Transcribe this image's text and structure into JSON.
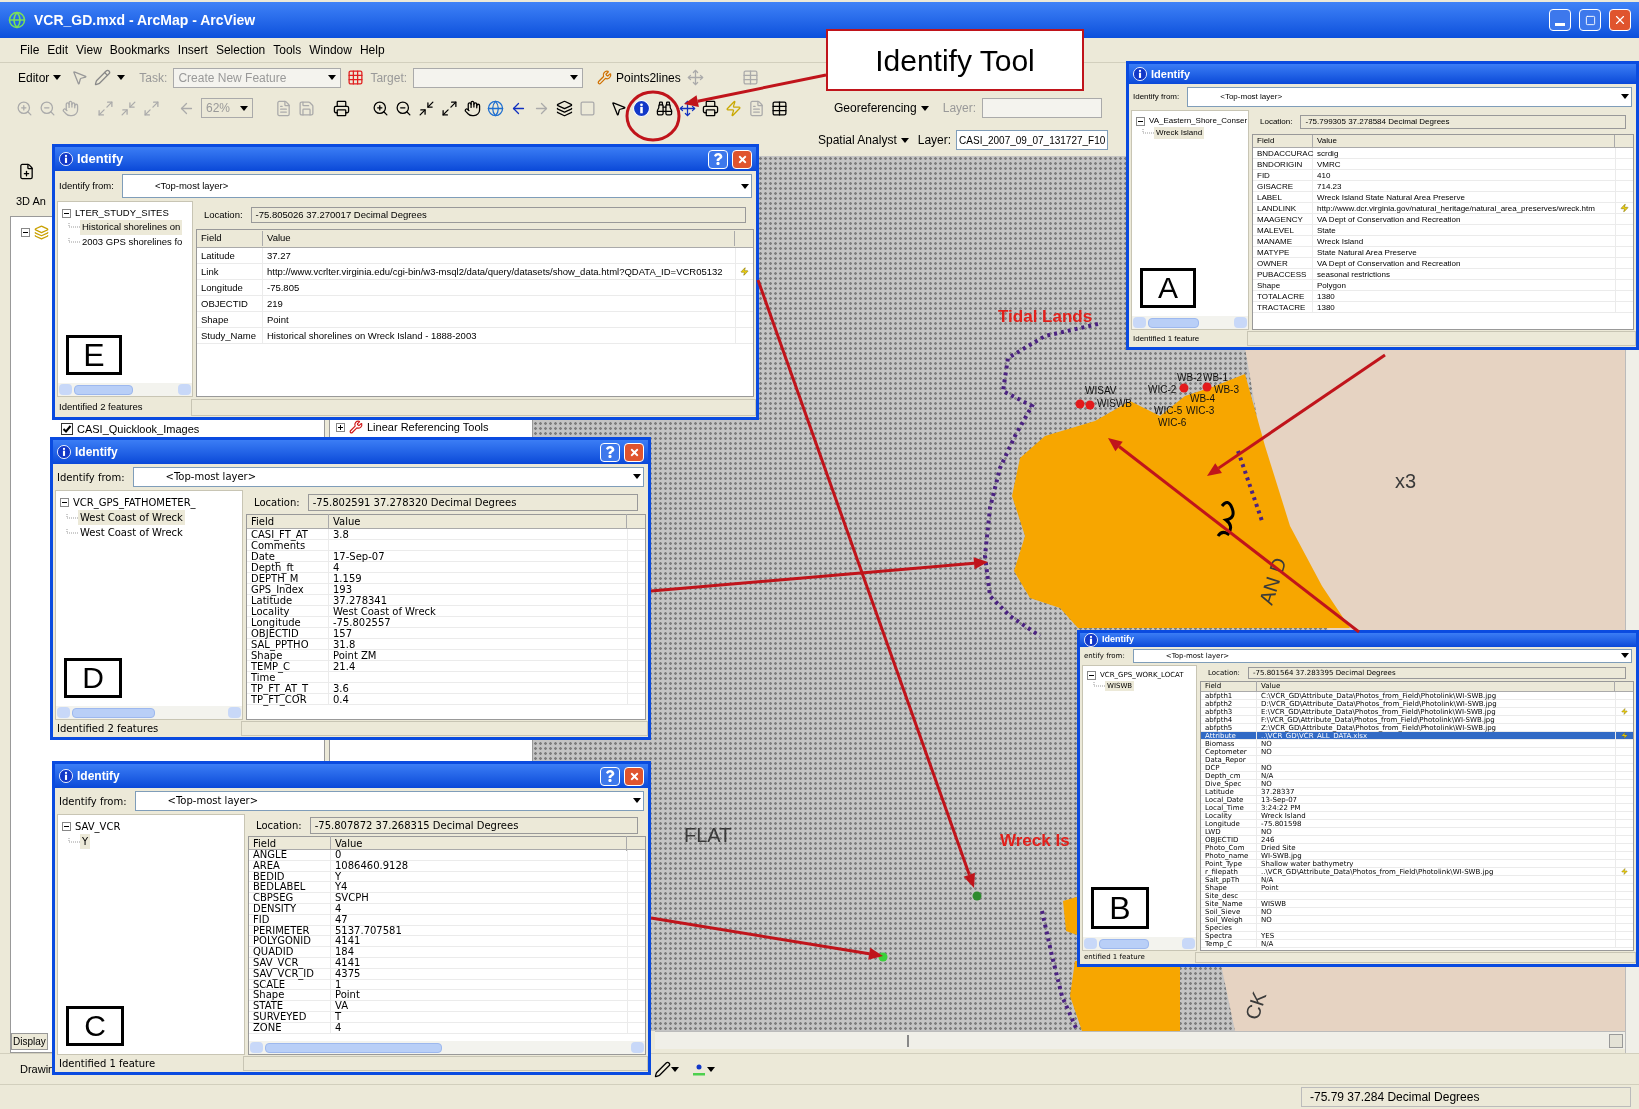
{
  "window": {
    "title": "VCR_GD.mxd - ArcMap - ArcView"
  },
  "menu": [
    "File",
    "Edit",
    "View",
    "Bookmarks",
    "Insert",
    "Selection",
    "Tools",
    "Window",
    "Help"
  ],
  "editor_toolbar": {
    "editor": "Editor",
    "task_label": "Task:",
    "task": "Create New Feature",
    "target_label": "Target:",
    "tool": "Points2lines"
  },
  "tools_toolbar": {
    "zoom": "62%"
  },
  "georef_toolbar": {
    "label": "Georeferencing",
    "layer_label": "Layer:"
  },
  "spatial_toolbar": {
    "label": "Spatial Analyst",
    "layer_label": "Layer:",
    "layer": "CASI_2007_09_07_131727_F10"
  },
  "side_toolbar": {
    "label": "3D An"
  },
  "toc": {
    "item": "CASI_Quicklook_Images",
    "checked": true,
    "tab": "Display"
  },
  "toolbox": {
    "item": "Linear Referencing Tools"
  },
  "drawing_toolbar": {
    "label": "Drawin"
  },
  "map": {
    "labels": [
      {
        "text": "Tidal Lands",
        "kind": "place"
      },
      {
        "text": "FLAT",
        "kind": "terrain"
      },
      {
        "text": "Wreck Is",
        "kind": "place"
      },
      {
        "text": "AN D",
        "kind": "terrain"
      },
      {
        "text": "x3",
        "kind": "terrain"
      },
      {
        "text": "CK",
        "kind": "terrain"
      },
      {
        "text": "WISAV",
        "kind": "site"
      },
      {
        "text": "WISWB",
        "kind": "site"
      },
      {
        "text": "WB-2",
        "kind": "site"
      },
      {
        "text": "WB-1",
        "kind": "site"
      },
      {
        "text": "WIC-2",
        "kind": "site"
      },
      {
        "text": "WB-4",
        "kind": "site"
      },
      {
        "text": "WB-3",
        "kind": "site"
      },
      {
        "text": "WIC-5",
        "kind": "site"
      },
      {
        "text": "WIC-3",
        "kind": "site"
      },
      {
        "text": "WIC-6",
        "kind": "site"
      }
    ],
    "points": [
      {
        "color": "#e31a1c"
      },
      {
        "color": "#e31a1c"
      },
      {
        "color": "#e31a1c"
      },
      {
        "color": "#e31a1c"
      },
      {
        "color": "#2e8b2e"
      },
      {
        "color": "#3ad13a"
      }
    ]
  },
  "callout": {
    "text": "Identify Tool"
  },
  "identify_windows": [
    {
      "marker": "A",
      "title": "Identify",
      "title_buttons": false,
      "from_label": "Identify from:",
      "from": "<Top-most layer>",
      "layer": "VA_Eastern_Shore_Conser",
      "features": [
        {
          "name": "Wreck Island",
          "selected": true
        }
      ],
      "location_label": "Location:",
      "location": "-75.799305  37.278584 Decimal Degrees",
      "columns": [
        "Field",
        "Value"
      ],
      "rows": [
        {
          "field": "BNDACCURAC",
          "value": "scrdig",
          "link": false,
          "selected": false
        },
        {
          "field": "BNDORIGIN",
          "value": "VMRC",
          "link": false,
          "selected": false
        },
        {
          "field": "FID",
          "value": "410",
          "link": false,
          "selected": false
        },
        {
          "field": "GISACRE",
          "value": "714.23",
          "link": false,
          "selected": false
        },
        {
          "field": "LABEL",
          "value": "Wreck Island State Natural Area Preserve",
          "link": false,
          "selected": false
        },
        {
          "field": "LANDLINK",
          "value": "http://www.dcr.virginia.gov/natural_heritage/natural_area_preserves/wreck.htm",
          "link": true,
          "selected": false
        },
        {
          "field": "MAAGENCY",
          "value": "VA Dept of Conservation and Recreation",
          "link": false,
          "selected": false
        },
        {
          "field": "MALEVEL",
          "value": "State",
          "link": false,
          "selected": false
        },
        {
          "field": "MANAME",
          "value": "Wreck Island",
          "link": false,
          "selected": false
        },
        {
          "field": "MATYPE",
          "value": "State Natural Area Preserve",
          "link": false,
          "selected": false
        },
        {
          "field": "OWNER",
          "value": "VA Dept of Conservation and Recreation",
          "link": false,
          "selected": false
        },
        {
          "field": "PUBACCESS",
          "value": "seasonal restrictions",
          "link": false,
          "selected": false
        },
        {
          "field": "Shape",
          "value": "Polygon",
          "link": false,
          "selected": false
        },
        {
          "field": "TOTALACRE",
          "value": "1380",
          "link": false,
          "selected": false
        },
        {
          "field": "TRACTACRE",
          "value": "1380",
          "link": false,
          "selected": false
        }
      ],
      "status": "Identified 1 feature"
    },
    {
      "marker": "E",
      "title": "Identify",
      "title_buttons": true,
      "from_label": "Identify from:",
      "from": "<Top-most layer>",
      "layer": "LTER_STUDY_SITES",
      "features": [
        {
          "name": "Historical shorelines on",
          "selected": true
        },
        {
          "name": "2003 GPS shorelines fo",
          "selected": false
        }
      ],
      "location_label": "Location:",
      "location": "-75.805026  37.270017 Decimal Degrees",
      "columns": [
        "Field",
        "Value"
      ],
      "rows": [
        {
          "field": "Latitude",
          "value": "37.27",
          "link": false,
          "selected": false
        },
        {
          "field": "Link",
          "value": "http://www.vcrlter.virginia.edu/cgi-bin/w3-msql2/data/query/datasets/show_data.html?QDATA_ID=VCR05132",
          "link": true,
          "selected": false
        },
        {
          "field": "Longitude",
          "value": "-75.805",
          "link": false,
          "selected": false
        },
        {
          "field": "OBJECTID",
          "value": "219",
          "link": false,
          "selected": false
        },
        {
          "field": "Shape",
          "value": "Point",
          "link": false,
          "selected": false
        },
        {
          "field": "Study_Name",
          "value": "Historical shorelines on Wreck Island - 1888-2003",
          "link": false,
          "selected": false
        }
      ],
      "status": "Identified 2 features"
    },
    {
      "marker": "D",
      "title": "Identify",
      "title_buttons": true,
      "from_label": "Identify from:",
      "from": "<Top-most layer>",
      "layer": "VCR_GPS_FATHOMETER_",
      "features": [
        {
          "name": "West Coast of Wreck",
          "selected": true
        },
        {
          "name": "West Coast of Wreck",
          "selected": false
        }
      ],
      "location_label": "Location:",
      "location": "-75.802591  37.278320 Decimal Degrees",
      "columns": [
        "Field",
        "Value"
      ],
      "rows": [
        {
          "field": "CASI_FT_AT",
          "value": "3.8",
          "link": false,
          "selected": false
        },
        {
          "field": "Comments",
          "link": false,
          "selected": false
        },
        {
          "field": "Date_",
          "value": "17-Sep-07",
          "link": false,
          "selected": false
        },
        {
          "field": "Depth_ft",
          "value": "4",
          "link": false,
          "selected": false
        },
        {
          "field": "DEPTH_M",
          "value": "1.159",
          "link": false,
          "selected": false
        },
        {
          "field": "GPS_Index",
          "value": "193",
          "link": false,
          "selected": false
        },
        {
          "field": "Latitude",
          "value": "37.278341",
          "link": false,
          "selected": false
        },
        {
          "field": "Locality",
          "value": "West Coast of Wreck",
          "link": false,
          "selected": false
        },
        {
          "field": "Longitude",
          "value": "-75.802557",
          "link": false,
          "selected": false
        },
        {
          "field": "OBJECTID",
          "value": "157",
          "link": false,
          "selected": false
        },
        {
          "field": "SAL_PPTHO",
          "value": "31.8",
          "link": false,
          "selected": false
        },
        {
          "field": "Shape",
          "value": "Point ZM",
          "link": false,
          "selected": false
        },
        {
          "field": "TEMP_C",
          "value": "21.4",
          "link": false,
          "selected": false
        },
        {
          "field": "Time",
          "link": false,
          "selected": false
        },
        {
          "field": "TP_FT_AT_T",
          "value": "3.6",
          "link": false,
          "selected": false
        },
        {
          "field": "TP_FT_COR",
          "value": "0.4",
          "link": false,
          "selected": false
        }
      ],
      "status": "Identified 2 features"
    },
    {
      "marker": "B",
      "title": "Identify",
      "title_buttons": false,
      "from_label": "entify from:",
      "from": "<Top-most layer>",
      "layer": "VCR_GPS_WORK_LOCAT",
      "features": [
        {
          "name": "WISWB",
          "selected": true
        }
      ],
      "location_label": "Location:",
      "location": "-75.801564  37.283395 Decimal Degrees",
      "columns": [
        "Field",
        "Value"
      ],
      "rows": [
        {
          "field": "abfpth1",
          "value": "C:\\VCR_GD\\Attribute_Data\\Photos_from_Field\\Photolink\\WI-SWB.jpg",
          "link": false,
          "selected": false
        },
        {
          "field": "abfpth2",
          "value": "D:\\VCR_GD\\Attribute_Data\\Photos_from_Field\\Photolink\\WI-SWB.jpg",
          "link": false,
          "selected": false
        },
        {
          "field": "abfpth3",
          "value": "E:\\VCR_GD\\Attribute_Data\\Photos_from_Field\\Photolink\\WI-SWB.jpg",
          "link": true,
          "selected": false
        },
        {
          "field": "abfpth4",
          "value": "F:\\VCR_GD\\Attribute_Data\\Photos_from_Field\\Photolink\\WI-SWB.jpg",
          "link": false,
          "selected": false
        },
        {
          "field": "abfpth5",
          "value": "Z:\\VCR_GD\\Attribute_Data\\Photos_from_Field\\Photolink\\WI-SWB.jpg",
          "link": false,
          "selected": false
        },
        {
          "field": "Attribute_",
          "value": "..\\VCR_GD\\VCR_ALL_DATA.xlsx",
          "link": true,
          "selected": true
        },
        {
          "field": "Biomass",
          "value": "NO",
          "link": false,
          "selected": false
        },
        {
          "field": "Ceptometer",
          "value": "NO",
          "link": false,
          "selected": false
        },
        {
          "field": "Data_Repor",
          "link": false,
          "selected": false
        },
        {
          "field": "DCP",
          "value": "NO",
          "link": false,
          "selected": false
        },
        {
          "field": "Depth_cm",
          "value": "N/A",
          "link": false,
          "selected": false
        },
        {
          "field": "Dive_Spec",
          "value": "NO",
          "link": false,
          "selected": false
        },
        {
          "field": "Latitude",
          "value": "37.28337",
          "link": false,
          "selected": false
        },
        {
          "field": "Local_Date",
          "value": "13-Sep-07",
          "link": false,
          "selected": false
        },
        {
          "field": "Local_Time",
          "value": "3:24:22 PM",
          "link": false,
          "selected": false
        },
        {
          "field": "Locality",
          "value": "Wreck Island",
          "link": false,
          "selected": false
        },
        {
          "field": "Longitude",
          "value": "-75.801598",
          "link": false,
          "selected": false
        },
        {
          "field": "LWD",
          "value": "NO",
          "link": false,
          "selected": false
        },
        {
          "field": "OBJECTID",
          "value": "246",
          "link": false,
          "selected": false
        },
        {
          "field": "Photo_Com",
          "value": "Dried Site",
          "link": false,
          "selected": false
        },
        {
          "field": "Photo_name",
          "value": "WI-SWB.jpg",
          "link": false,
          "selected": false
        },
        {
          "field": "Point_Type",
          "value": "Shallow water bathymetry",
          "link": false,
          "selected": false
        },
        {
          "field": "r_filepath",
          "value": "..\\VCR_GD\\Attribute_Data\\Photos_from_Field\\Photolink\\WI-SWB.jpg",
          "link": true,
          "selected": false
        },
        {
          "field": "Salt_ppTh",
          "value": "N/A",
          "link": false,
          "selected": false
        },
        {
          "field": "Shape",
          "value": "Point",
          "link": false,
          "selected": false
        },
        {
          "field": "Site_desc",
          "link": false,
          "selected": false
        },
        {
          "field": "Site_Name",
          "value": "WISWB",
          "link": false,
          "selected": false
        },
        {
          "field": "Soil_Sieve",
          "value": "NO",
          "link": false,
          "selected": false
        },
        {
          "field": "Soil_Weigh",
          "value": "NO",
          "link": false,
          "selected": false
        },
        {
          "field": "Species",
          "link": false,
          "selected": false
        },
        {
          "field": "Spectra",
          "value": "YES",
          "link": false,
          "selected": false
        },
        {
          "field": "Temp_C",
          "value": "N/A",
          "link": false,
          "selected": false
        }
      ],
      "status": "entified 1 feature"
    },
    {
      "marker": "C",
      "title": "Identify",
      "title_buttons": true,
      "from_label": "Identify from:",
      "from": "<Top-most layer>",
      "layer": "SAV_VCR",
      "features": [
        {
          "name": "Y",
          "selected": true
        }
      ],
      "location_label": "Location:",
      "location": "-75.807872  37.268315 Decimal Degrees",
      "columns": [
        "Field",
        "Value"
      ],
      "rows": [
        {
          "field": "ANGLE",
          "value": "0",
          "link": false,
          "selected": false
        },
        {
          "field": "AREA",
          "value": "1086460.9128",
          "link": false,
          "selected": false
        },
        {
          "field": "BEDID",
          "value": "Y",
          "link": false,
          "selected": false
        },
        {
          "field": "BEDLABEL",
          "value": "Y4",
          "link": false,
          "selected": false
        },
        {
          "field": "CBPSEG",
          "value": "SVCPH",
          "link": false,
          "selected": false
        },
        {
          "field": "DENSITY",
          "value": "4",
          "link": false,
          "selected": false
        },
        {
          "field": "FID",
          "value": "47",
          "link": false,
          "selected": false
        },
        {
          "field": "PERIMETER",
          "value": "5137.707581",
          "link": false,
          "selected": false
        },
        {
          "field": "POLYGONID",
          "value": "4141",
          "link": false,
          "selected": false
        },
        {
          "field": "QUADID",
          "value": "184",
          "link": false,
          "selected": false
        },
        {
          "field": "SAV_VCR_",
          "value": "4141",
          "link": false,
          "selected": false
        },
        {
          "field": "SAV_VCR_ID",
          "value": "4375",
          "link": false,
          "selected": false
        },
        {
          "field": "SCALE",
          "value": "1",
          "link": false,
          "selected": false
        },
        {
          "field": "Shape",
          "value": "Point",
          "link": false,
          "selected": false
        },
        {
          "field": "STATE",
          "value": "VA",
          "link": false,
          "selected": false
        },
        {
          "field": "SURVEYED",
          "value": "T",
          "link": false,
          "selected": false
        },
        {
          "field": "ZONE",
          "value": "4",
          "link": false,
          "selected": false
        }
      ],
      "status": "Identified 1 feature"
    }
  ],
  "status_bar": {
    "coordinates": "-75.79  37.284 Decimal Degrees"
  }
}
